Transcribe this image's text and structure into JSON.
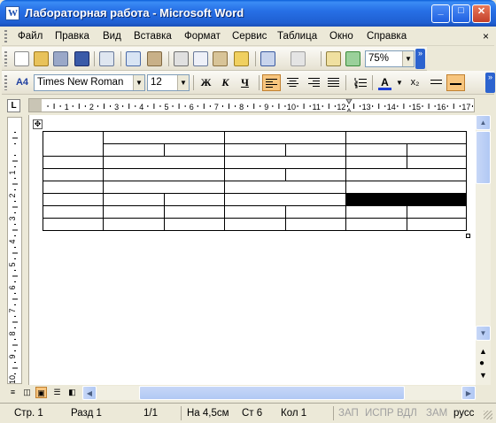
{
  "window": {
    "title": "Лабораторная работа - Microsoft Word",
    "icon_letter": "W",
    "min_label": "_",
    "max_label": "□",
    "close_label": "✕"
  },
  "menu": {
    "items": [
      "Файл",
      "Правка",
      "Вид",
      "Вставка",
      "Формат",
      "Сервис",
      "Таблица",
      "Окно",
      "Справка"
    ],
    "close_label": "×"
  },
  "standard_toolbar": {
    "zoom": "75%"
  },
  "formatting_toolbar": {
    "style_icon": "A4",
    "font": "Times New Roman",
    "size": "12",
    "bold": "Ж",
    "italic": "К",
    "underline": "Ч",
    "subscript": "x₂",
    "font_color_letter": "A"
  },
  "ruler": {
    "tab_marker": "L",
    "numbers": [
      "1",
      "2",
      "3",
      "4",
      "5",
      "6",
      "7",
      "8",
      "9",
      "10",
      "11",
      "12",
      "13",
      "14",
      "15",
      "16",
      "17"
    ]
  },
  "document": {
    "table_move_handle": "✥"
  },
  "status_bar": {
    "page": "Стр. 1",
    "section": "Разд 1",
    "pages": "1/1",
    "at": "На 4,5см",
    "line": "Ст 6",
    "col": "Кол 1",
    "rec": "ЗАП",
    "trk": "ИСПР",
    "ext": "ВДЛ",
    "ovr": "ЗАМ",
    "lang": "русс"
  },
  "colors": {
    "title_bar": "#2770e6",
    "chrome": "#ece9d8",
    "active_button": "#f7c57e",
    "font_color_bar": "#1e3fd6"
  }
}
